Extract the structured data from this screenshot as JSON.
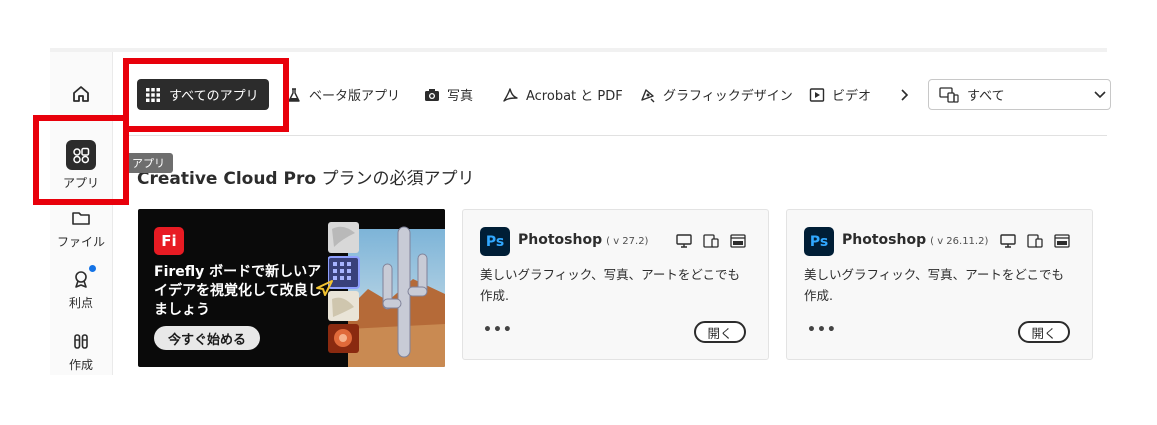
{
  "sidebar": {
    "items": [
      {
        "name": "home",
        "label": "",
        "icon": "home-icon"
      },
      {
        "name": "apps",
        "label": "アプリ",
        "icon": "apps-icon"
      },
      {
        "name": "files",
        "label": "ファイル",
        "icon": "folder-icon"
      },
      {
        "name": "benefits",
        "label": "利点",
        "icon": "award-icon"
      },
      {
        "name": "create",
        "label": "作成",
        "icon": "create-icon"
      }
    ]
  },
  "tabs": {
    "all": "すべてのアプリ",
    "beta": "ベータ版アプリ",
    "photo": "写真",
    "acrobat": "Acrobat と PDF",
    "graphic": "グラフィックデザイン",
    "video": "ビデオ"
  },
  "filter": {
    "value": "すべて"
  },
  "tooltip": "アプリ",
  "section": {
    "title_latin": "Creative Cloud Pro",
    "title_jp": " プランの必須アプリ"
  },
  "promo": {
    "logo": "Fi",
    "text": "Firefly ボードで新しいアイデアを視覚化して改良しましょう",
    "button": "今すぐ始める"
  },
  "cards": [
    {
      "logo": "Ps",
      "name": "Photoshop",
      "version": "( v 27.2)",
      "description": "美しいグラフィック、写真、アートをどこでも作成.",
      "more": "•••",
      "open": "開く"
    },
    {
      "logo": "Ps",
      "name": "Photoshop",
      "version": "( v 26.11.2)",
      "description": "美しいグラフィック、写真、アートをどこでも作成.",
      "more": "•••",
      "open": "開く"
    }
  ],
  "colors": {
    "accent_red": "#e8000b",
    "ps_blue": "#31a8ff",
    "ps_bg": "#001e36",
    "firefly_red": "#e81b23",
    "badge_blue": "#1473e6"
  }
}
